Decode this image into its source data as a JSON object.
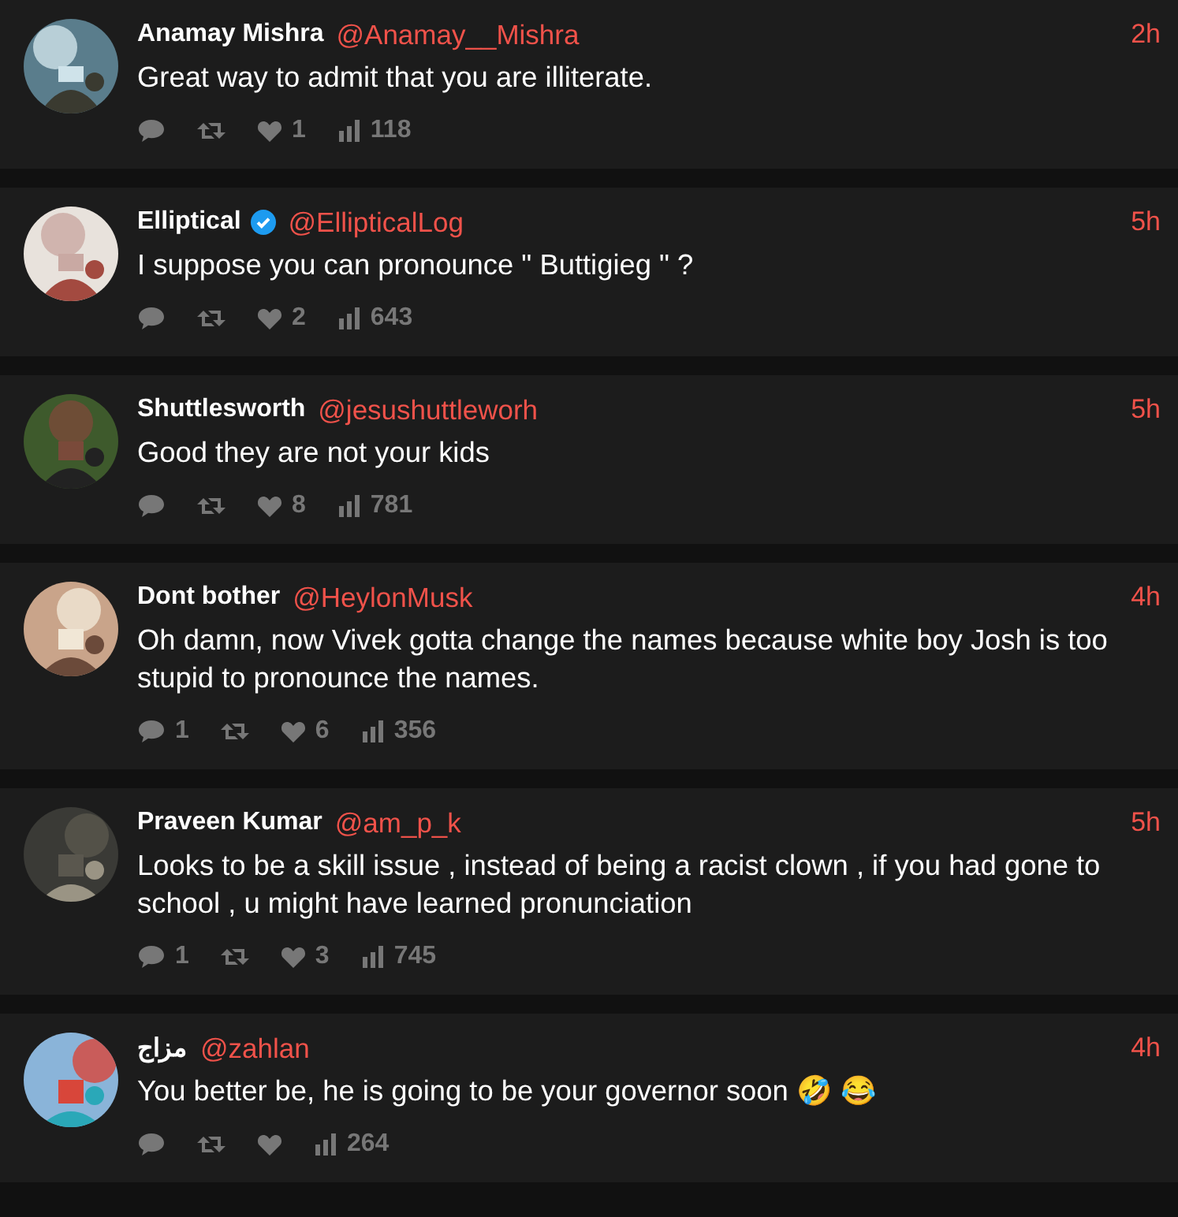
{
  "replies": [
    {
      "name": "Anamay Mishra",
      "verified": false,
      "handle": "@Anamay__Mishra",
      "time": "2h",
      "text": "Great way to admit that you are illiterate.",
      "like_count": "1",
      "view_count": "118"
    },
    {
      "name": "Elliptical",
      "verified": true,
      "handle": "@EllipticalLog",
      "time": "5h",
      "text": "I suppose you can pronounce \" Buttigieg \" ?",
      "like_count": "2",
      "view_count": "643"
    },
    {
      "name": "Shuttlesworth",
      "verified": false,
      "handle": "@jesushuttleworh",
      "time": "5h",
      "text": "Good they are not your kids",
      "like_count": "8",
      "view_count": "781"
    },
    {
      "name": "Dont bother",
      "verified": false,
      "handle": "@HeylonMusk",
      "time": "4h",
      "text": "Oh damn, now Vivek gotta change the names because white boy Josh is too stupid to pronounce the names.",
      "reply_count": "1",
      "like_count": "6",
      "view_count": "356"
    },
    {
      "name": "Praveen Kumar",
      "verified": false,
      "handle": "@am_p_k",
      "time": "5h",
      "text": "Looks to be a skill issue , instead of being a racist clown , if you had gone to school , u might have learned pronunciation",
      "reply_count": "1",
      "like_count": "3",
      "view_count": "745"
    },
    {
      "name": "مزاج",
      "verified": false,
      "handle": "@zahlan",
      "time": "4h",
      "text": "You better be, he is going to be your governor soon 🤣 😂",
      "view_count": "264"
    }
  ]
}
